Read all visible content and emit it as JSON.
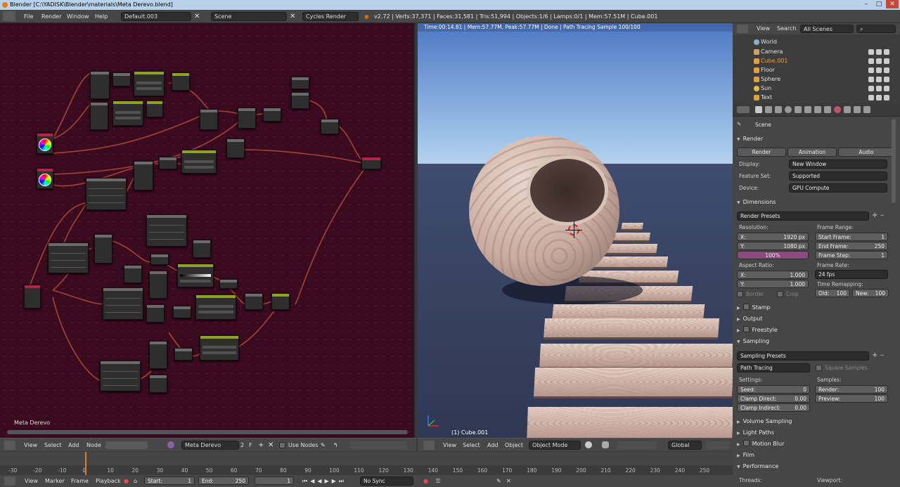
{
  "window": {
    "title": "Blender  [C:\\YADISK\\Blender\\materials\\Meta Derevo.blend]"
  },
  "topbar": {
    "menus": [
      "File",
      "Render",
      "Window",
      "Help"
    ],
    "layout": "Default.003",
    "scene": "Scene",
    "engine": "Cycles Render",
    "stats": "v2.72 | Verts:37,371 | Faces:31,581 | Tris:51,994 | Objects:1/6 | Lamps:0/1 | Mem:57.51M | Cube.001"
  },
  "node_editor": {
    "label": "Meta Derevo",
    "header": {
      "menus": [
        "View",
        "Select",
        "Add",
        "Node"
      ],
      "material": "Meta Derevo",
      "users": "2",
      "fake": "F",
      "use_nodes": "Use Nodes"
    }
  },
  "viewport": {
    "render_info": "Time:00:14.81 | Mem:57.77M, Peak:57.77M | Done | Path Tracing Sample 100/100",
    "object_label": "(1) Cube.001",
    "header": {
      "menus": [
        "View",
        "Select",
        "Add",
        "Object"
      ],
      "mode": "Object Mode",
      "orientation": "Global"
    }
  },
  "outliner": {
    "menus": [
      "View",
      "Search"
    ],
    "filter": "All Scenes",
    "items": [
      {
        "name": "World",
        "color": "#8ab0d0",
        "selected": false
      },
      {
        "name": "Camera",
        "color": "#d0a060",
        "selected": false
      },
      {
        "name": "Cube.001",
        "color": "#e0a040",
        "selected": true
      },
      {
        "name": "Floor",
        "color": "#e0a040",
        "selected": false
      },
      {
        "name": "Sphere",
        "color": "#e0a040",
        "selected": false
      },
      {
        "name": "Sun",
        "color": "#e0c040",
        "selected": false
      },
      {
        "name": "Text",
        "color": "#e0a040",
        "selected": false
      }
    ]
  },
  "properties": {
    "scene": "Scene",
    "render": {
      "title": "Render",
      "buttons": [
        "Render",
        "Animation",
        "Audio"
      ],
      "display_label": "Display:",
      "display": "New Window",
      "feature_label": "Feature Set:",
      "feature": "Supported",
      "device_label": "Device:",
      "device": "GPU Compute"
    },
    "dimensions": {
      "title": "Dimensions",
      "presets": "Render Presets",
      "resolution_label": "Resolution:",
      "x_label": "X:",
      "x": "1920 px",
      "y_label": "Y:",
      "y": "1080 px",
      "percent": "100%",
      "frame_range_label": "Frame Range:",
      "start_label": "Start Frame:",
      "start": "1",
      "end_label": "End Frame:",
      "end": "250",
      "step_label": "Frame Step:",
      "step": "1",
      "aspect_label": "Aspect Ratio:",
      "ax_label": "X:",
      "ax": "1.000",
      "ay_label": "Y:",
      "ay": "1.000",
      "frame_rate_label": "Frame Rate:",
      "frame_rate": "24 fps",
      "remap_label": "Time Remapping:",
      "old_label": "Old:",
      "old": "100",
      "new_label": "New:",
      "new": "100",
      "border": "Border",
      "crop": "Crop"
    },
    "closed_sections": [
      "Stamp",
      "Output",
      "Freestyle"
    ],
    "sampling": {
      "title": "Sampling",
      "presets": "Sampling Presets",
      "integrator": "Path Tracing",
      "square": "Square Samples",
      "settings_label": "Settings:",
      "seed_label": "Seed:",
      "seed": "0",
      "clamp_direct_label": "Clamp Direct:",
      "clamp_direct": "0.00",
      "clamp_indirect_label": "Clamp Indirect:",
      "clamp_indirect": "0.00",
      "samples_label": "Samples:",
      "render_label": "Render:",
      "render": "100",
      "preview_label": "Preview:",
      "preview": "100"
    },
    "more_sections": [
      "Volume Sampling",
      "Light Paths",
      "Motion Blur",
      "Film",
      "Performance"
    ],
    "threads_label": "Threads:",
    "viewport_label": "Viewport:"
  },
  "timeline": {
    "ticks": [
      "-30",
      "-20",
      "-10",
      "0",
      "10",
      "20",
      "30",
      "40",
      "50",
      "60",
      "70",
      "80",
      "90",
      "100",
      "110",
      "120",
      "130",
      "140",
      "150",
      "160",
      "170",
      "180",
      "190",
      "200",
      "210",
      "220",
      "230",
      "240",
      "250"
    ],
    "current_frame": 1
  },
  "bottombar": {
    "menus": [
      "View",
      "Marker",
      "Frame",
      "Playback"
    ],
    "start_label": "Start:",
    "start": "1",
    "end_label": "End:",
    "end": "250",
    "current": "1",
    "sync": "No Sync"
  }
}
